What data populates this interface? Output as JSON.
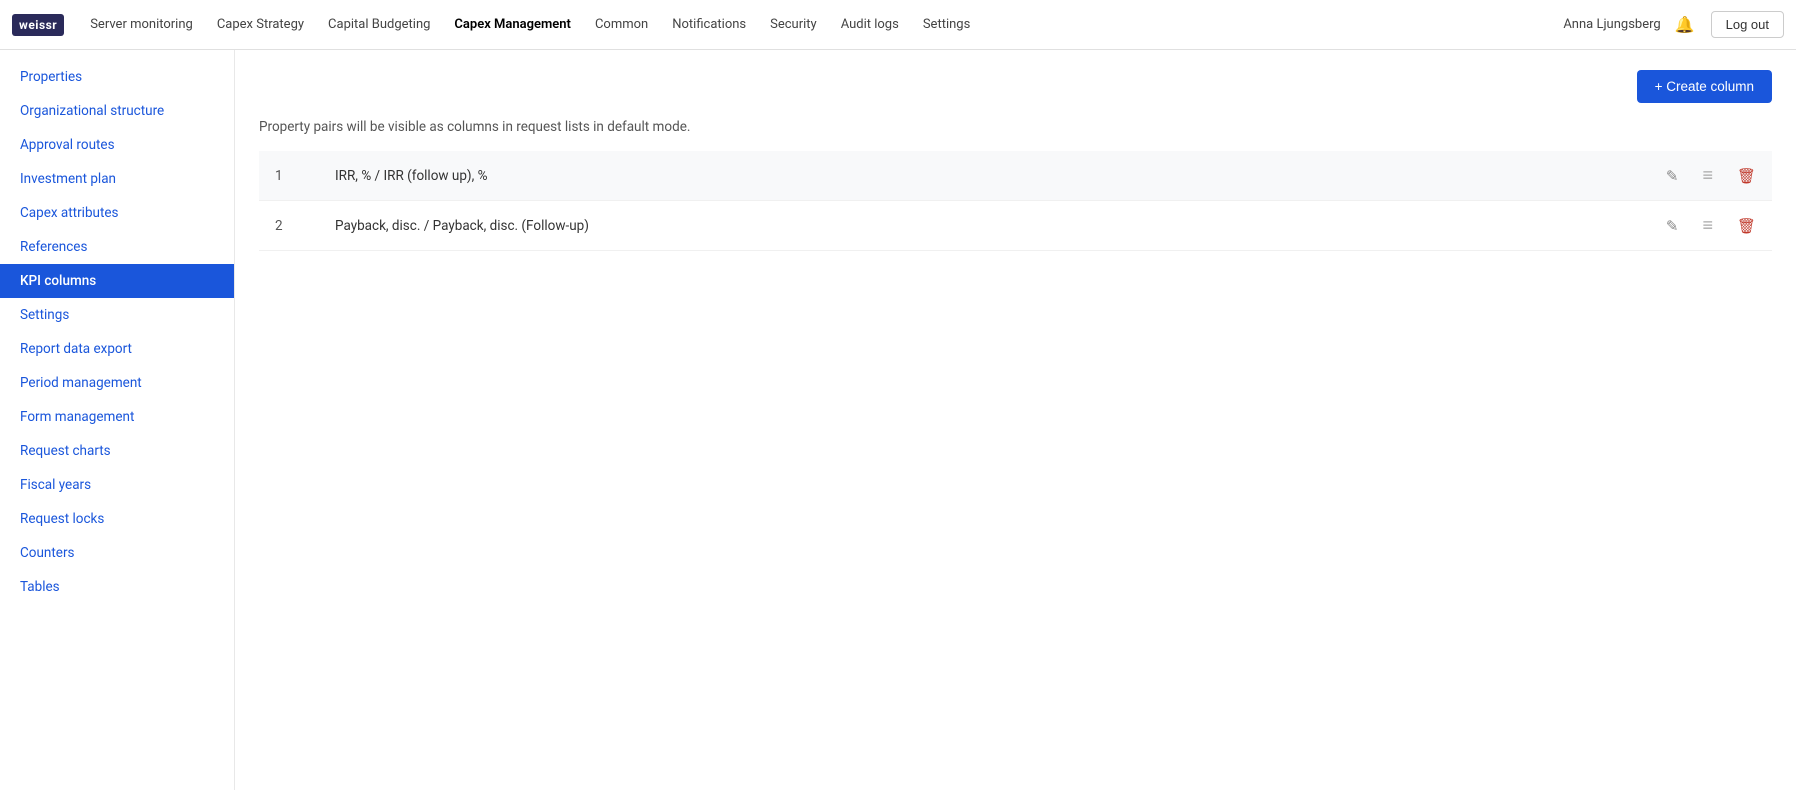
{
  "app": {
    "logo": "weissr"
  },
  "topnav": {
    "items": [
      {
        "id": "server-monitoring",
        "label": "Server monitoring",
        "active": false
      },
      {
        "id": "capex-strategy",
        "label": "Capex Strategy",
        "active": false
      },
      {
        "id": "capital-budgeting",
        "label": "Capital Budgeting",
        "active": false
      },
      {
        "id": "capex-management",
        "label": "Capex Management",
        "active": true
      },
      {
        "id": "common",
        "label": "Common",
        "active": false
      },
      {
        "id": "notifications",
        "label": "Notifications",
        "active": false
      },
      {
        "id": "security",
        "label": "Security",
        "active": false
      },
      {
        "id": "audit-logs",
        "label": "Audit logs",
        "active": false
      },
      {
        "id": "settings",
        "label": "Settings",
        "active": false
      }
    ],
    "user": "Anna Ljungsberg",
    "logout_label": "Log out"
  },
  "sidebar": {
    "items": [
      {
        "id": "properties",
        "label": "Properties",
        "active": false
      },
      {
        "id": "organizational-structure",
        "label": "Organizational structure",
        "active": false
      },
      {
        "id": "approval-routes",
        "label": "Approval routes",
        "active": false
      },
      {
        "id": "investment-plan",
        "label": "Investment plan",
        "active": false
      },
      {
        "id": "capex-attributes",
        "label": "Capex attributes",
        "active": false
      },
      {
        "id": "references",
        "label": "References",
        "active": false
      },
      {
        "id": "kpi-columns",
        "label": "KPI columns",
        "active": true
      },
      {
        "id": "settings",
        "label": "Settings",
        "active": false
      },
      {
        "id": "report-data-export",
        "label": "Report data export",
        "active": false
      },
      {
        "id": "period-management",
        "label": "Period management",
        "active": false
      },
      {
        "id": "form-management",
        "label": "Form management",
        "active": false
      },
      {
        "id": "request-charts",
        "label": "Request charts",
        "active": false
      },
      {
        "id": "fiscal-years",
        "label": "Fiscal years",
        "active": false
      },
      {
        "id": "request-locks",
        "label": "Request locks",
        "active": false
      },
      {
        "id": "counters",
        "label": "Counters",
        "active": false
      },
      {
        "id": "tables",
        "label": "Tables",
        "active": false
      }
    ]
  },
  "content": {
    "create_button_label": "+ Create column",
    "subtitle": "Property pairs will be visible as columns in request lists in default mode.",
    "rows": [
      {
        "num": "1",
        "label": "IRR, % / IRR (follow up), %"
      },
      {
        "num": "2",
        "label": "Payback, disc. / Payback, disc. (Follow-up)"
      }
    ]
  }
}
